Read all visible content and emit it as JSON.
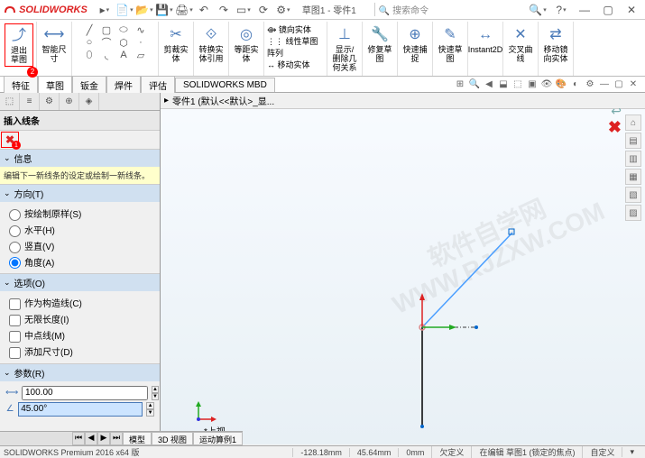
{
  "app_name": "SOLIDWORKS",
  "doc_name": "草图1 - 零件1",
  "search_placeholder": "搜索命令",
  "ribbon": {
    "exit_sketch": "退出草图",
    "exit_badge": "2",
    "smart_dim": "智能尺寸",
    "trim": "剪裁实体",
    "convert": "转换实体引用",
    "offset": "等距实体",
    "mirror": "镜向实体",
    "pattern": "线性草图阵列",
    "move": "移动实体",
    "show_del": "显示/删除几何关系",
    "repair": "修复草图",
    "quick_snap": "快速捕捉",
    "quick_sketch": "快速草图",
    "instant2d": "Instant2D",
    "cross_curve": "交叉曲线",
    "move_entity": "移动镜向实体"
  },
  "tabs": [
    "特征",
    "草图",
    "钣金",
    "焊件",
    "评估",
    "SOLIDWORKS MBD"
  ],
  "tabs_active": 1,
  "breadcrumb": "零件1 (默认<<默认>_显...",
  "panel": {
    "title": "插入线条",
    "dismiss_badge": "1",
    "info_hdr": "信息",
    "info_text": "编辑下一新线条的设定或绘制一新线条。",
    "orient_hdr": "方向(T)",
    "orient_opts": [
      "按绘制原样(S)",
      "水平(H)",
      "竖直(V)",
      "角度(A)"
    ],
    "orient_sel": 3,
    "options_hdr": "选项(O)",
    "options_opts": [
      "作为构造线(C)",
      "无限长度(I)",
      "中点线(M)",
      "添加尺寸(D)"
    ],
    "params_hdr": "参数(R)",
    "param_len": "100.00",
    "param_ang": "45.00°"
  },
  "view_label": "*上视",
  "bottom_tabs": [
    "模型",
    "3D 视图",
    "运动算例1"
  ],
  "statusbar": {
    "product": "SOLIDWORKS Premium 2016 x64 版",
    "x": "-128.18mm",
    "y": "45.64mm",
    "z": "0mm",
    "def": "欠定义",
    "editing": "在编辑 草图1 (锁定的焦点)",
    "custom": "自定义"
  },
  "watermark": "软件自学网\nWWW.RJZXW.COM"
}
